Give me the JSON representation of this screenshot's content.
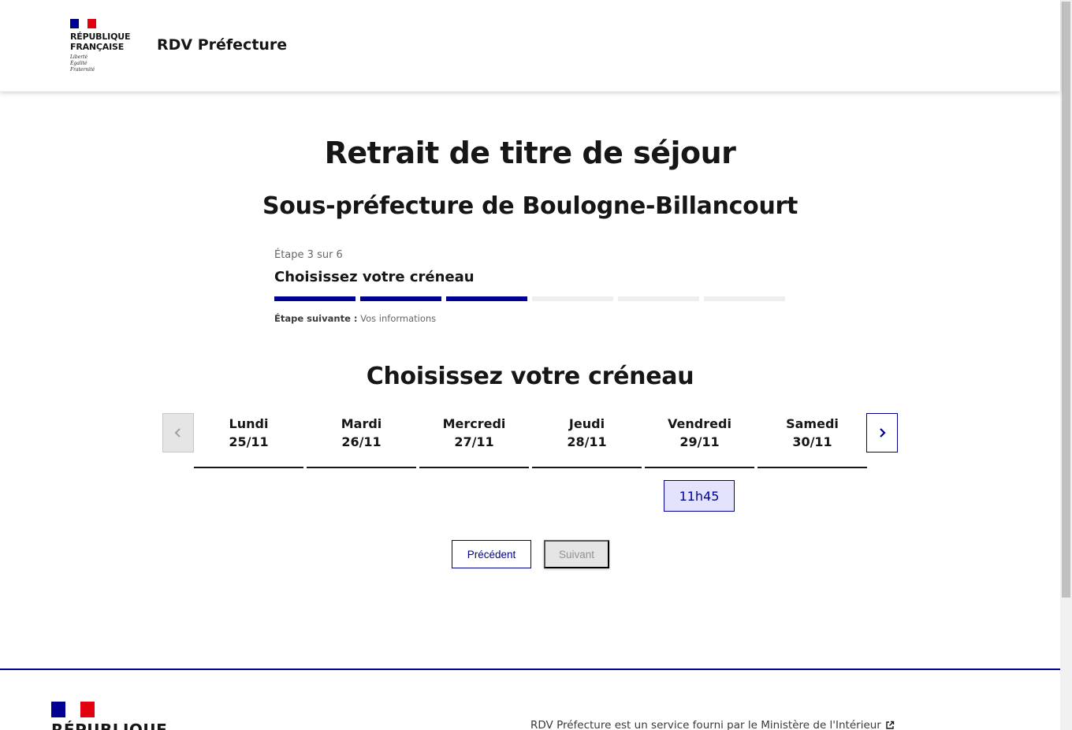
{
  "header": {
    "logo_line1": "RÉPUBLIQUE",
    "logo_line2": "FRANÇAISE",
    "motto1": "Liberté",
    "motto2": "Égalité",
    "motto3": "Fraternité",
    "service_title": "RDV Préfecture"
  },
  "main": {
    "title": "Retrait de titre de séjour",
    "subtitle": "Sous-préfecture de Boulogne-Billancourt",
    "stepper": {
      "state": "Étape 3 sur 6",
      "title": "Choisissez votre créneau",
      "current_step": 3,
      "total_steps": 6,
      "next_label": "Étape suivante :",
      "next_value": "Vos informations"
    },
    "section_title": "Choisissez votre créneau",
    "calendar": {
      "prev_icon": "chevron-left-icon",
      "next_icon": "chevron-right-icon",
      "days": [
        {
          "name": "Lundi",
          "date": "25/11"
        },
        {
          "name": "Mardi",
          "date": "26/11"
        },
        {
          "name": "Mercredi",
          "date": "27/11"
        },
        {
          "name": "Jeudi",
          "date": "28/11"
        },
        {
          "name": "Vendredi",
          "date": "29/11"
        },
        {
          "name": "Samedi",
          "date": "30/11"
        }
      ],
      "slot": "11h45"
    },
    "actions": {
      "previous": "Précédent",
      "next": "Suivant"
    }
  },
  "footer": {
    "republique": "RÉPUBLIQUE",
    "service_text": "RDV Préfecture est un service fourni par le Ministère de l'Intérieur",
    "external_icon": "external-link-icon"
  },
  "colors": {
    "primary": "#000091",
    "flag_red": "#e1000f",
    "slot_bg": "#e3e3fd",
    "disabled_bg": "#e5e5e5"
  }
}
